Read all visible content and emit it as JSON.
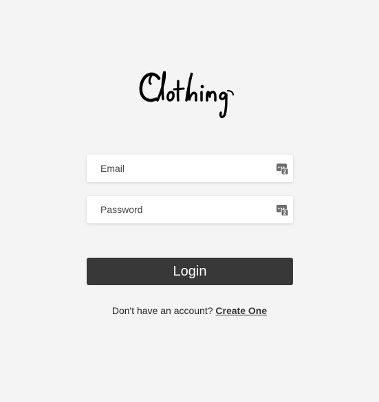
{
  "brand": {
    "logo_text": "Clothing"
  },
  "form": {
    "email_placeholder": "Email",
    "password_placeholder": "Password",
    "login_label": "Login"
  },
  "signup": {
    "prompt": "Don't have an account?",
    "link_label": "Create One"
  },
  "icons": {
    "field_icon": "password-manager-icon"
  },
  "colors": {
    "background": "#f4f4f4",
    "button_bg": "#383838",
    "button_text": "#ffffff"
  }
}
